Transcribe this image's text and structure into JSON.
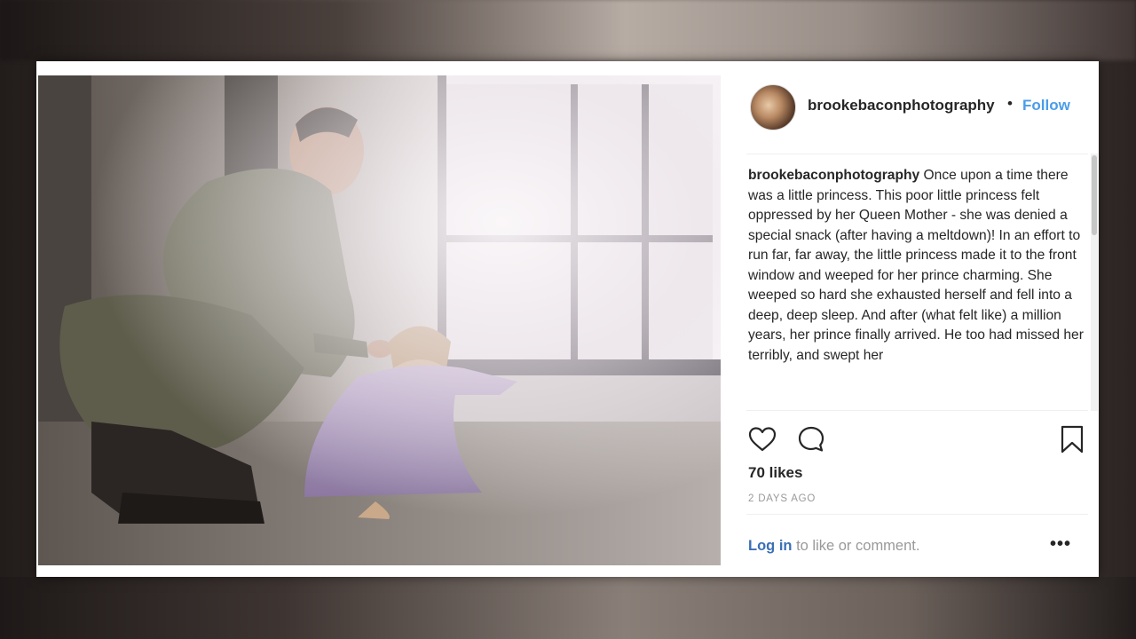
{
  "post": {
    "username": "brookebaconphotography",
    "separator": "•",
    "follow_label": "Follow",
    "caption_username": "brookebaconphotography",
    "caption_text": " Once upon a time there was a little princess. This poor little princess felt oppressed by her Queen Mother - she was denied a special snack (after having a meltdown)! In an effort to run far, far away, the little princess made it to the front window and weeped for her prince charming. She weeped so hard she exhausted herself and fell into a deep, deep sleep. And after (what felt like) a million years, her prince finally arrived. He too had missed her terribly, and swept her",
    "likes": "70 likes",
    "timestamp": "2 DAYS AGO",
    "login_link": "Log in",
    "login_rest": " to like or comment.",
    "more_label": "•••"
  },
  "icons": {
    "like": "heart-icon",
    "comment": "comment-icon",
    "save": "bookmark-icon",
    "more": "more-options-icon"
  },
  "colors": {
    "follow": "#4a9de8",
    "text": "#262626",
    "muted": "#999999",
    "login_link": "#3b6fb6"
  }
}
